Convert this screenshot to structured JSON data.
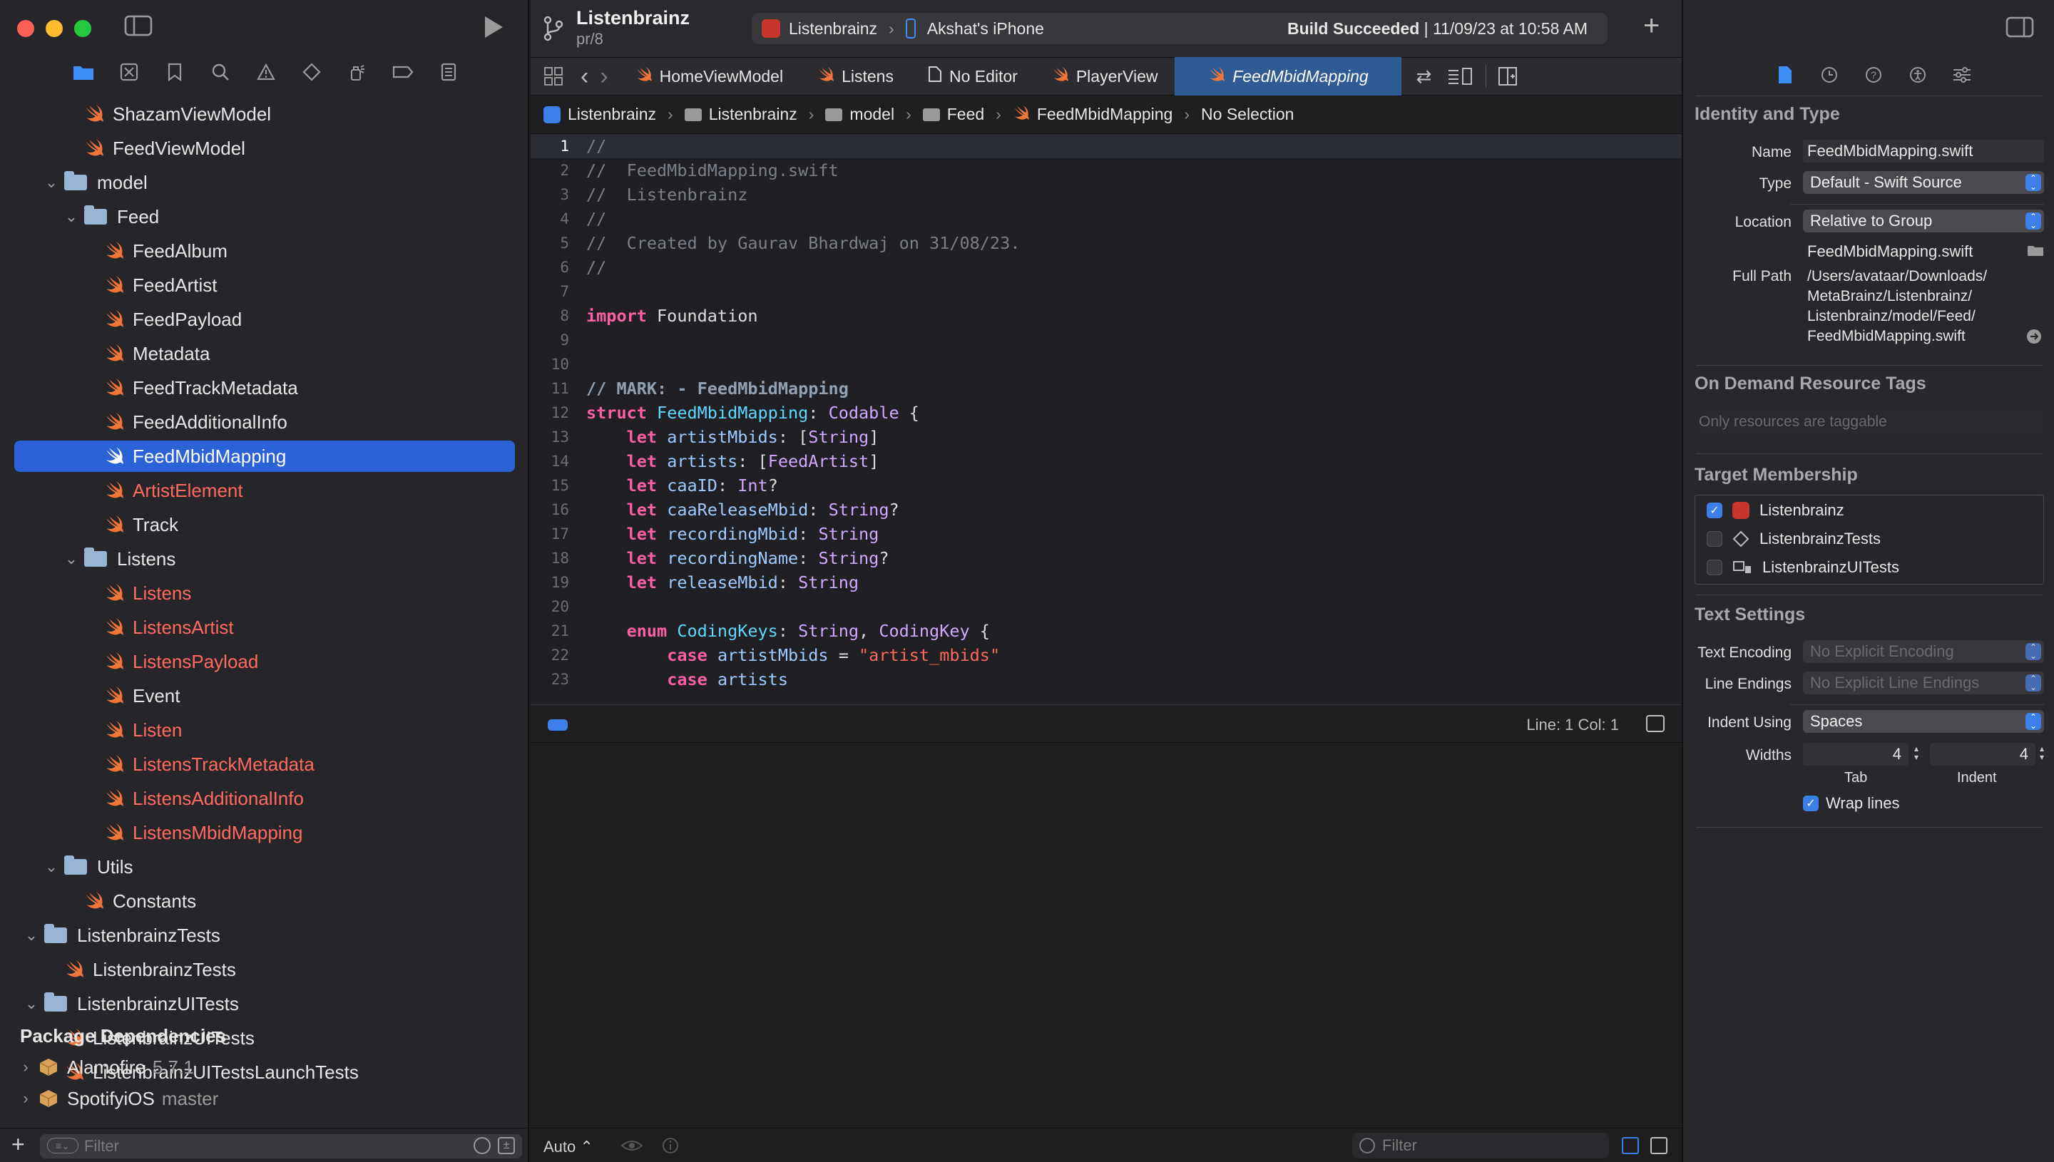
{
  "navigator": {
    "tree": [
      {
        "label": "ShazamViewModel",
        "kind": "swift",
        "indent": 2,
        "red": false
      },
      {
        "label": "FeedViewModel",
        "kind": "swift",
        "indent": 2,
        "red": false
      },
      {
        "label": "model",
        "kind": "folder",
        "indent": 1,
        "red": false
      },
      {
        "label": "Feed",
        "kind": "folder",
        "indent": 2,
        "red": false
      },
      {
        "label": "FeedAlbum",
        "kind": "swift",
        "indent": 3,
        "red": false
      },
      {
        "label": "FeedArtist",
        "kind": "swift",
        "indent": 3,
        "red": false
      },
      {
        "label": "FeedPayload",
        "kind": "swift",
        "indent": 3,
        "red": false
      },
      {
        "label": "Metadata",
        "kind": "swift",
        "indent": 3,
        "red": false
      },
      {
        "label": "FeedTrackMetadata",
        "kind": "swift",
        "indent": 3,
        "red": false
      },
      {
        "label": "FeedAdditionalInfo",
        "kind": "swift",
        "indent": 3,
        "red": false
      },
      {
        "label": "FeedMbidMapping",
        "kind": "swift",
        "indent": 3,
        "red": false,
        "selected": true
      },
      {
        "label": "ArtistElement",
        "kind": "swift",
        "indent": 3,
        "red": true
      },
      {
        "label": "Track",
        "kind": "swift",
        "indent": 3,
        "red": false
      },
      {
        "label": "Listens",
        "kind": "folder",
        "indent": 2,
        "red": false
      },
      {
        "label": "Listens",
        "kind": "swift",
        "indent": 3,
        "red": true
      },
      {
        "label": "ListensArtist",
        "kind": "swift",
        "indent": 3,
        "red": true
      },
      {
        "label": "ListensPayload",
        "kind": "swift",
        "indent": 3,
        "red": true
      },
      {
        "label": "Event",
        "kind": "swift",
        "indent": 3,
        "red": false
      },
      {
        "label": "Listen",
        "kind": "swift",
        "indent": 3,
        "red": true
      },
      {
        "label": "ListensTrackMetadata",
        "kind": "swift",
        "indent": 3,
        "red": true
      },
      {
        "label": "ListensAdditionalInfo",
        "kind": "swift",
        "indent": 3,
        "red": true
      },
      {
        "label": "ListensMbidMapping",
        "kind": "swift",
        "indent": 3,
        "red": true
      },
      {
        "label": "Utils",
        "kind": "folder",
        "indent": 1,
        "red": false
      },
      {
        "label": "Constants",
        "kind": "swift",
        "indent": 2,
        "red": false
      },
      {
        "label": "ListenbrainzTests",
        "kind": "folder",
        "indent": 0,
        "red": false
      },
      {
        "label": "ListenbrainzTests",
        "kind": "swift",
        "indent": 1,
        "red": false
      },
      {
        "label": "ListenbrainzUITests",
        "kind": "folder",
        "indent": 0,
        "red": false
      },
      {
        "label": "ListenbrainzUITests",
        "kind": "swift",
        "indent": 1,
        "red": false
      },
      {
        "label": "ListenbrainzUITestsLaunchTests",
        "kind": "swift",
        "indent": 1,
        "red": false
      }
    ],
    "package_section_title": "Package Dependencies",
    "packages": [
      {
        "name": "Alamofire",
        "version": "5.7.1"
      },
      {
        "name": "SpotifyiOS",
        "version": "master"
      }
    ],
    "filter_placeholder": "Filter"
  },
  "titlebar": {
    "project": "Listenbrainz",
    "branch": "pr/8",
    "scheme": "Listenbrainz",
    "device": "Akshat's iPhone",
    "build_status_bold": "Build Succeeded",
    "build_status_rest": " | 11/09/23 at 10:58 AM"
  },
  "tabs": [
    {
      "label": "HomeViewModel",
      "icon": "swift"
    },
    {
      "label": "Listens",
      "icon": "swift"
    },
    {
      "label": "No Editor",
      "icon": "doc"
    },
    {
      "label": "PlayerView",
      "icon": "swift"
    },
    {
      "label": "FeedMbidMapping",
      "icon": "swift",
      "active": true
    }
  ],
  "jumpbar": [
    "Listenbrainz",
    "Listenbrainz",
    "model",
    "Feed",
    "FeedMbidMapping",
    "No Selection"
  ],
  "code_lines": [
    {
      "n": "1",
      "html": "<span class='cm'>//</span>"
    },
    {
      "n": "2",
      "html": "<span class='cm'>//  FeedMbidMapping.swift</span>"
    },
    {
      "n": "3",
      "html": "<span class='cm'>//  Listenbrainz</span>"
    },
    {
      "n": "4",
      "html": "<span class='cm'>//</span>"
    },
    {
      "n": "5",
      "html": "<span class='cm'>//  Created by Gaurav Bhardwaj on 31/08/23.</span>"
    },
    {
      "n": "6",
      "html": "<span class='cm'>//</span>"
    },
    {
      "n": "7",
      "html": ""
    },
    {
      "n": "8",
      "html": "<span class='kw'>import</span> Foundation"
    },
    {
      "n": "9",
      "html": ""
    },
    {
      "n": "10",
      "html": ""
    },
    {
      "n": "11",
      "html": "<span class='mk'>// MARK: - FeedMbidMapping</span>"
    },
    {
      "n": "12",
      "html": "<span class='kw'>struct</span> <span class='tyb'>FeedMbidMapping</span>: <span class='ty'>Codable</span> {"
    },
    {
      "n": "13",
      "html": "    <span class='kw'>let</span> <span class='pr'>artistMbids</span>: [<span class='ty'>String</span>]"
    },
    {
      "n": "14",
      "html": "    <span class='kw'>let</span> <span class='pr'>artists</span>: [<span class='ty'>FeedArtist</span>]"
    },
    {
      "n": "15",
      "html": "    <span class='kw'>let</span> <span class='pr'>caaID</span>: <span class='ty'>Int</span>?"
    },
    {
      "n": "16",
      "html": "    <span class='kw'>let</span> <span class='pr'>caaReleaseMbid</span>: <span class='ty'>String</span>?"
    },
    {
      "n": "17",
      "html": "    <span class='kw'>let</span> <span class='pr'>recordingMbid</span>: <span class='ty'>String</span>"
    },
    {
      "n": "18",
      "html": "    <span class='kw'>let</span> <span class='pr'>recordingName</span>: <span class='ty'>String</span>?"
    },
    {
      "n": "19",
      "html": "    <span class='kw'>let</span> <span class='pr'>releaseMbid</span>: <span class='ty'>String</span>"
    },
    {
      "n": "20",
      "html": ""
    },
    {
      "n": "21",
      "html": "    <span class='kw'>enum</span> <span class='tyb'>CodingKeys</span>: <span class='ty'>String</span>, <span class='ty'>CodingKey</span> {"
    },
    {
      "n": "22",
      "html": "        <span class='kw'>case</span> <span class='pr'>artistMbids</span> = <span class='st'>\"artist_mbids\"</span>"
    },
    {
      "n": "23",
      "html": "        <span class='kw'>case</span> <span class='pr'>artists</span>"
    }
  ],
  "editor_status": {
    "line_col": "Line: 1  Col: 1"
  },
  "debugbar": {
    "auto_label": "Auto ⌃",
    "filter_placeholder": "Filter"
  },
  "inspector": {
    "identity_title": "Identity and Type",
    "name_label": "Name",
    "name_value": "FeedMbidMapping.swift",
    "type_label": "Type",
    "type_value": "Default - Swift Source",
    "location_label": "Location",
    "location_value": "Relative to Group",
    "location_file": "FeedMbidMapping.swift",
    "full_path_label": "Full Path",
    "full_path_lines": [
      "/Users/avataar/Downloads/",
      "MetaBrainz/Listenbrainz/",
      "Listenbrainz/model/Feed/",
      "FeedMbidMapping.swift"
    ],
    "odr_title": "On Demand Resource Tags",
    "odr_placeholder": "Only resources are taggable",
    "target_title": "Target Membership",
    "targets": [
      {
        "label": "Listenbrainz",
        "checked": true
      },
      {
        "label": "ListenbrainzTests",
        "checked": false
      },
      {
        "label": "ListenbrainzUITests",
        "checked": false
      }
    ],
    "text_title": "Text Settings",
    "encoding_label": "Text Encoding",
    "encoding_value": "No Explicit Encoding",
    "endings_label": "Line Endings",
    "endings_value": "No Explicit Line Endings",
    "indent_label": "Indent Using",
    "indent_value": "Spaces",
    "widths_label": "Widths",
    "tab_width": "4",
    "indent_width": "4",
    "tab_caption": "Tab",
    "indent_caption": "Indent",
    "wrap_label": "Wrap lines",
    "wrap_checked": true
  },
  "colors": {
    "accent": "#3d7fe8",
    "selection": "#2b63d6",
    "swift_orange": "#f0753a",
    "missing_file_red": "#ff6a5f"
  }
}
